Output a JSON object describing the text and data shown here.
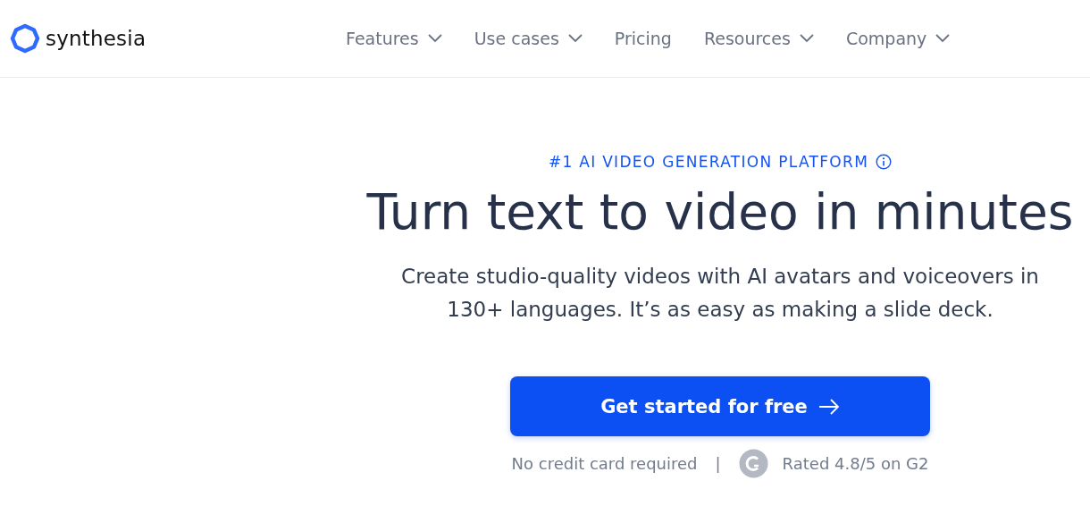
{
  "header": {
    "logo_text": "synthesia",
    "nav": [
      {
        "label": "Features",
        "has_menu": true
      },
      {
        "label": "Use cases",
        "has_menu": true
      },
      {
        "label": "Pricing",
        "has_menu": false
      },
      {
        "label": "Resources",
        "has_menu": true
      },
      {
        "label": "Company",
        "has_menu": true
      }
    ]
  },
  "hero": {
    "eyebrow": "#1 AI VIDEO GENERATION PLATFORM",
    "title": "Turn text to video in minutes",
    "subtitle": "Create studio-quality videos with AI avatars and voiceovers in 130+ languages. It’s as easy as making a slide deck.",
    "cta": "Get started for free",
    "note": "No credit card required",
    "separator": "|",
    "rating": "Rated 4.8/5 on G2"
  }
}
